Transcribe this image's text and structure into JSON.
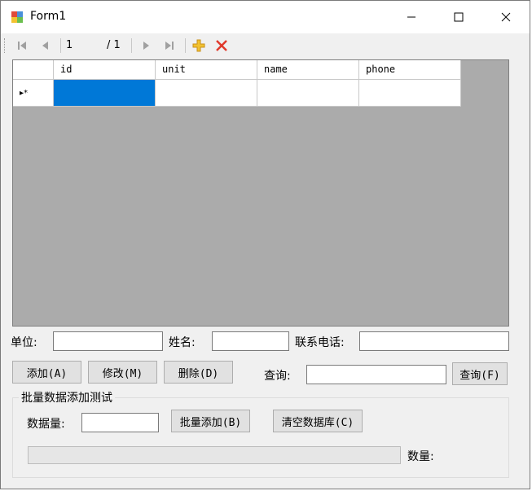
{
  "window": {
    "title": "Form1",
    "minimize": "—",
    "maximize": "☐",
    "close": "✕"
  },
  "navigator": {
    "position": "1",
    "count": "/ 1"
  },
  "grid": {
    "columns": [
      "id",
      "unit",
      "name",
      "phone"
    ],
    "new_row_marker": "▸*"
  },
  "form": {
    "unit_label": "单位:",
    "name_label": "姓名:",
    "phone_label": "联系电话:",
    "add_button": "添加(A)",
    "modify_button": "修改(M)",
    "delete_button": "删除(D)",
    "query_label": "查询:",
    "query_button": "查询(F)"
  },
  "batch": {
    "group_title": "批量数据添加测试",
    "amount_label": "数据量:",
    "batch_add_button": "批量添加(B)",
    "clear_db_button": "清空数据库(C)",
    "count_label": "数量:",
    "progress": 0
  }
}
